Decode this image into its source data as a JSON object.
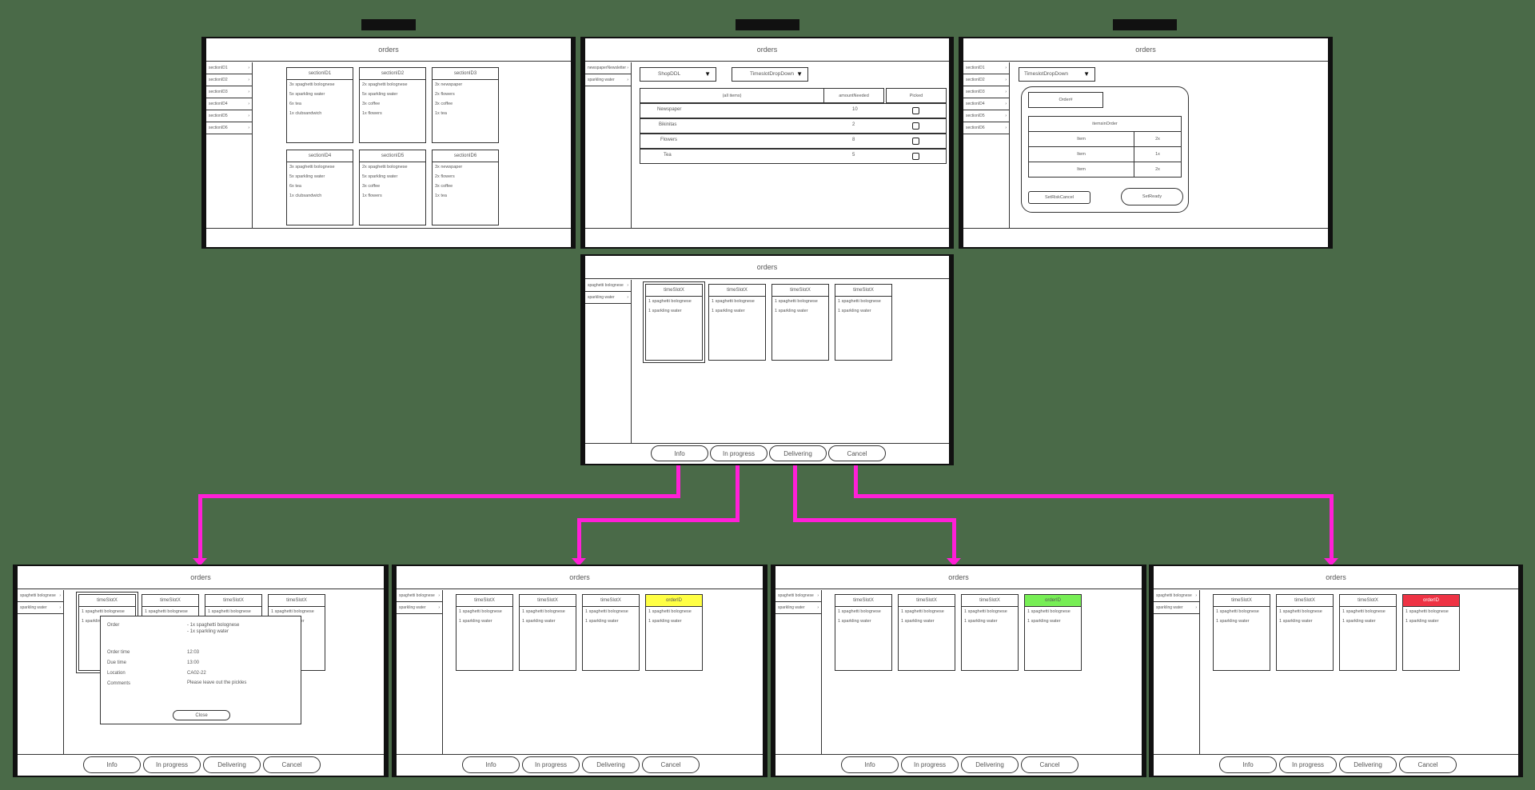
{
  "window_title": "orders",
  "colors": {
    "background": "#4a6a48",
    "flow_arrow": "#ff1fd7",
    "badge_yellow": "#ffff44",
    "badge_green": "#77ee55",
    "badge_red": "#ee3344"
  },
  "top_left": {
    "sidebar": [
      "sectionID1",
      "sectionID2",
      "sectionID3",
      "sectionID4",
      "sectionID5",
      "sectionID6"
    ],
    "cards": [
      {
        "header": "sectionID1",
        "lines": [
          "3x spaghetti bolognese",
          "5x sparkling water",
          "6x tea",
          "1x clubsandwich"
        ]
      },
      {
        "header": "sectionID2",
        "lines": [
          "2x spaghetti bolognese",
          "5x sparkling water",
          "3x coffee",
          "1x flowers"
        ]
      },
      {
        "header": "sectionID3",
        "lines": [
          "3x newspaper",
          "2x flowers",
          "3x coffee",
          "1x tea"
        ]
      },
      {
        "header": "sectionID4",
        "lines": [
          "3x spaghetti bolognese",
          "5x sparkling water",
          "6x tea",
          "1x clubsandwich"
        ]
      },
      {
        "header": "sectionID5",
        "lines": [
          "2x spaghetti bolognese",
          "5x sparkling water",
          "3x coffee",
          "1x flowers"
        ]
      },
      {
        "header": "sectionID6",
        "lines": [
          "3x newspaper",
          "2x flowers",
          "3x coffee",
          "1x tea"
        ]
      }
    ]
  },
  "top_middle": {
    "sidebar": [
      "newspaperNewsletter",
      "sparkling water"
    ],
    "shop_dropdown": "ShopDDL",
    "timeslot_dropdown": "TimeslotDropDown",
    "table_headers": [
      "(all items)",
      "amountNeeded",
      "Picked"
    ],
    "table_rows": [
      {
        "item": "Newspaper",
        "amount": "10"
      },
      {
        "item": "Bikinitas",
        "amount": "2"
      },
      {
        "item": "Flowers",
        "amount": "8"
      },
      {
        "item": "Tea",
        "amount": "5"
      }
    ]
  },
  "top_right": {
    "sidebar": [
      "sectionID1",
      "sectionID2",
      "sectionID3",
      "sectionID4",
      "sectionID5",
      "sectionID6"
    ],
    "timeslot_dropdown": "TimeslotDropDown",
    "order_label": "Order#",
    "order_table_header": "itemsinOrder",
    "order_rows": [
      {
        "item": "Item",
        "qty": "2x"
      },
      {
        "item": "Item",
        "qty": "1x"
      },
      {
        "item": "Item",
        "qty": "2x"
      }
    ],
    "set_button": "SetRiskCancel",
    "ready_button": "SetReady"
  },
  "center": {
    "sidebar": [
      "spaghetti bolognese",
      "sparkling water"
    ],
    "cards": [
      {
        "header": "timeSlotX",
        "lines": [
          "1 spaghetti bolognese",
          "1 sparkling water"
        ]
      },
      {
        "header": "timeSlotX",
        "lines": [
          "1 spaghetti bolognese",
          "1 sparkling water"
        ]
      },
      {
        "header": "timeSlotX",
        "lines": [
          "1 spaghetti bolognese",
          "1 sparkling water"
        ]
      },
      {
        "header": "timeSlotX",
        "lines": [
          "1 spaghetti bolognese",
          "1 sparkling water"
        ]
      }
    ],
    "buttons": [
      "Info",
      "In progress",
      "Delivering",
      "Cancel"
    ]
  },
  "bottom": {
    "sidebar": [
      "spaghetti bolognese",
      "sparkling water"
    ],
    "card_header": "timeSlotX",
    "card_lines": [
      "1 spaghetti bolognese",
      "1 sparkling water"
    ],
    "order_badge_yellow": "orderID",
    "order_badge_green": "orderID",
    "order_badge_red": "orderID",
    "buttons": [
      "Info",
      "In progress",
      "Delivering",
      "Cancel"
    ]
  },
  "info_popup": {
    "order_label": "Order",
    "order_lines": [
      "- 1x spaghetti bolognese",
      "- 1x sparkling water"
    ],
    "fields": [
      {
        "label": "Order time",
        "value": "12:03"
      },
      {
        "label": "Due time",
        "value": "13:00"
      },
      {
        "label": "Location",
        "value": "CA02-22"
      },
      {
        "label": "Comments",
        "value": "Please leave out the pickles"
      }
    ],
    "close_label": "Close"
  }
}
